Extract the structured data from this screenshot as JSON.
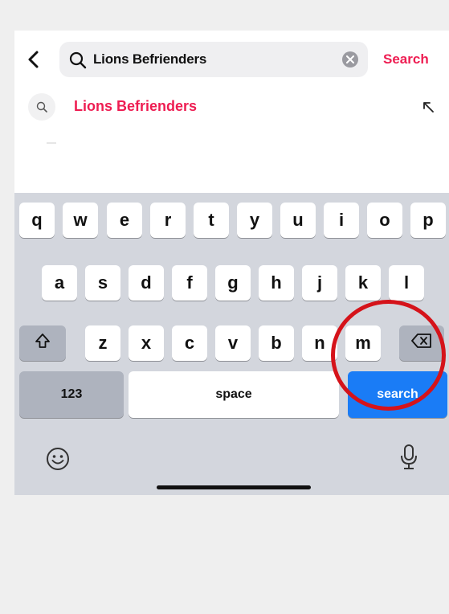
{
  "header": {
    "query": "Lions Befrienders",
    "search_action": "Search"
  },
  "suggestion": {
    "text": "Lions Befrienders"
  },
  "keyboard": {
    "row1": [
      "q",
      "w",
      "e",
      "r",
      "t",
      "y",
      "u",
      "i",
      "o",
      "p"
    ],
    "row2": [
      "a",
      "s",
      "d",
      "f",
      "g",
      "h",
      "j",
      "k",
      "l"
    ],
    "row3": [
      "z",
      "x",
      "c",
      "v",
      "b",
      "n",
      "m"
    ],
    "numbers_label": "123",
    "space_label": "space",
    "return_label": "search"
  },
  "icons": [
    "back-chevron-icon",
    "search-icon",
    "clear-icon",
    "search-icon",
    "arrow-up-left-icon",
    "shift-icon",
    "backspace-icon",
    "emoji-icon",
    "microphone-icon"
  ],
  "colors": {
    "accent": "#ee1d52",
    "return_key": "#1a7cf6",
    "annotation_circle": "#d5131a"
  }
}
